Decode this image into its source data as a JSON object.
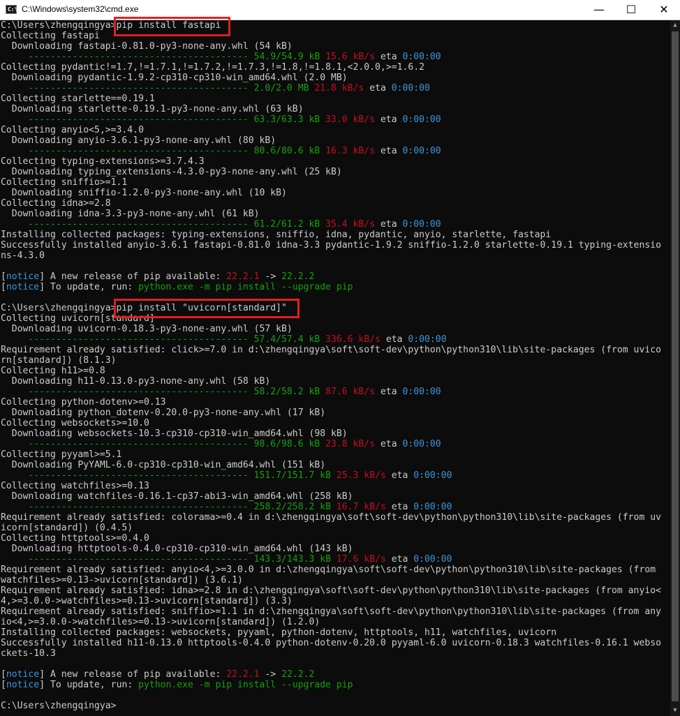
{
  "window": {
    "title": "C:\\Windows\\system32\\cmd.exe",
    "icon": "cmd-icon",
    "minimize_glyph": "—",
    "maximize_glyph": "☐",
    "close_glyph": "✕"
  },
  "colors": {
    "background": "#0c0c0c",
    "text": "#cccccc",
    "green": "#13a10e",
    "red": "#c50f1f",
    "cyan": "#3a96dd",
    "highlight": "#e02020"
  },
  "highlights": [
    {
      "label": "first-command",
      "text": "pip install fastapi"
    },
    {
      "label": "second-command",
      "text": "pip install \"uvicorn[standard]\""
    }
  ],
  "lines": [
    [
      {
        "t": "C:\\Users\\zhengqingya>pip install fastapi"
      }
    ],
    [
      {
        "t": "Collecting fastapi"
      }
    ],
    [
      {
        "t": "  Downloading fastapi-0.81.0-py3-none-any.whl (54 kB)"
      }
    ],
    [
      {
        "t": "     ---------------------------------------- ",
        "c": "g"
      },
      {
        "t": "54.9/54.9 kB",
        "c": "g"
      },
      {
        "t": " "
      },
      {
        "t": "15.6 kB/s",
        "c": "r"
      },
      {
        "t": " eta "
      },
      {
        "t": "0:00:00",
        "c": "c"
      }
    ],
    [
      {
        "t": "Collecting pydantic!=1.7,!=1.7.1,!=1.7.2,!=1.7.3,!=1.8,!=1.8.1,<2.0.0,>=1.6.2"
      }
    ],
    [
      {
        "t": "  Downloading pydantic-1.9.2-cp310-cp310-win_amd64.whl (2.0 MB)"
      }
    ],
    [
      {
        "t": "     ---------------------------------------- ",
        "c": "g"
      },
      {
        "t": "2.0/2.0 MB",
        "c": "g"
      },
      {
        "t": " "
      },
      {
        "t": "21.8 kB/s",
        "c": "r"
      },
      {
        "t": " eta "
      },
      {
        "t": "0:00:00",
        "c": "c"
      }
    ],
    [
      {
        "t": "Collecting starlette==0.19.1"
      }
    ],
    [
      {
        "t": "  Downloading starlette-0.19.1-py3-none-any.whl (63 kB)"
      }
    ],
    [
      {
        "t": "     ---------------------------------------- ",
        "c": "g"
      },
      {
        "t": "63.3/63.3 kB",
        "c": "g"
      },
      {
        "t": " "
      },
      {
        "t": "33.0 kB/s",
        "c": "r"
      },
      {
        "t": " eta "
      },
      {
        "t": "0:00:00",
        "c": "c"
      }
    ],
    [
      {
        "t": "Collecting anyio<5,>=3.4.0"
      }
    ],
    [
      {
        "t": "  Downloading anyio-3.6.1-py3-none-any.whl (80 kB)"
      }
    ],
    [
      {
        "t": "     ---------------------------------------- ",
        "c": "g"
      },
      {
        "t": "80.6/80.6 kB",
        "c": "g"
      },
      {
        "t": " "
      },
      {
        "t": "16.3 kB/s",
        "c": "r"
      },
      {
        "t": " eta "
      },
      {
        "t": "0:00:00",
        "c": "c"
      }
    ],
    [
      {
        "t": "Collecting typing-extensions>=3.7.4.3"
      }
    ],
    [
      {
        "t": "  Downloading typing_extensions-4.3.0-py3-none-any.whl (25 kB)"
      }
    ],
    [
      {
        "t": "Collecting sniffio>=1.1"
      }
    ],
    [
      {
        "t": "  Downloading sniffio-1.2.0-py3-none-any.whl (10 kB)"
      }
    ],
    [
      {
        "t": "Collecting idna>=2.8"
      }
    ],
    [
      {
        "t": "  Downloading idna-3.3-py3-none-any.whl (61 kB)"
      }
    ],
    [
      {
        "t": "     ---------------------------------------- ",
        "c": "g"
      },
      {
        "t": "61.2/61.2 kB",
        "c": "g"
      },
      {
        "t": " "
      },
      {
        "t": "35.4 kB/s",
        "c": "r"
      },
      {
        "t": " eta "
      },
      {
        "t": "0:00:00",
        "c": "c"
      }
    ],
    [
      {
        "t": "Installing collected packages: typing-extensions, sniffio, idna, pydantic, anyio, starlette, fastapi"
      }
    ],
    [
      {
        "t": "Successfully installed anyio-3.6.1 fastapi-0.81.0 idna-3.3 pydantic-1.9.2 sniffio-1.2.0 starlette-0.19.1 typing-extensio"
      }
    ],
    [
      {
        "t": "ns-4.3.0"
      }
    ],
    [
      {
        "t": ""
      }
    ],
    [
      {
        "t": "["
      },
      {
        "t": "notice",
        "c": "c"
      },
      {
        "t": "] A new release of pip available: "
      },
      {
        "t": "22.2.1",
        "c": "r"
      },
      {
        "t": " -> "
      },
      {
        "t": "22.2.2",
        "c": "g"
      }
    ],
    [
      {
        "t": "["
      },
      {
        "t": "notice",
        "c": "c"
      },
      {
        "t": "] To update, run: "
      },
      {
        "t": "python.exe -m pip install --upgrade pip",
        "c": "g"
      }
    ],
    [
      {
        "t": ""
      }
    ],
    [
      {
        "t": "C:\\Users\\zhengqingya>pip install \"uvicorn[standard]\""
      }
    ],
    [
      {
        "t": "Collecting uvicorn[standard]"
      }
    ],
    [
      {
        "t": "  Downloading uvicorn-0.18.3-py3-none-any.whl (57 kB)"
      }
    ],
    [
      {
        "t": "     ---------------------------------------- ",
        "c": "g"
      },
      {
        "t": "57.4/57.4 kB",
        "c": "g"
      },
      {
        "t": " "
      },
      {
        "t": "336.6 kB/s",
        "c": "r"
      },
      {
        "t": " eta "
      },
      {
        "t": "0:00:00",
        "c": "c"
      }
    ],
    [
      {
        "t": "Requirement already satisfied: click>=7.0 in d:\\zhengqingya\\soft\\soft-dev\\python\\python310\\lib\\site-packages (from uvico"
      }
    ],
    [
      {
        "t": "rn[standard]) (8.1.3)"
      }
    ],
    [
      {
        "t": "Collecting h11>=0.8"
      }
    ],
    [
      {
        "t": "  Downloading h11-0.13.0-py3-none-any.whl (58 kB)"
      }
    ],
    [
      {
        "t": "     ---------------------------------------- ",
        "c": "g"
      },
      {
        "t": "58.2/58.2 kB",
        "c": "g"
      },
      {
        "t": " "
      },
      {
        "t": "87.6 kB/s",
        "c": "r"
      },
      {
        "t": " eta "
      },
      {
        "t": "0:00:00",
        "c": "c"
      }
    ],
    [
      {
        "t": "Collecting python-dotenv>=0.13"
      }
    ],
    [
      {
        "t": "  Downloading python_dotenv-0.20.0-py3-none-any.whl (17 kB)"
      }
    ],
    [
      {
        "t": "Collecting websockets>=10.0"
      }
    ],
    [
      {
        "t": "  Downloading websockets-10.3-cp310-cp310-win_amd64.whl (98 kB)"
      }
    ],
    [
      {
        "t": "     ---------------------------------------- ",
        "c": "g"
      },
      {
        "t": "98.6/98.6 kB",
        "c": "g"
      },
      {
        "t": " "
      },
      {
        "t": "23.8 kB/s",
        "c": "r"
      },
      {
        "t": " eta "
      },
      {
        "t": "0:00:00",
        "c": "c"
      }
    ],
    [
      {
        "t": "Collecting pyyaml>=5.1"
      }
    ],
    [
      {
        "t": "  Downloading PyYAML-6.0-cp310-cp310-win_amd64.whl (151 kB)"
      }
    ],
    [
      {
        "t": "     ---------------------------------------- ",
        "c": "g"
      },
      {
        "t": "151.7/151.7 kB",
        "c": "g"
      },
      {
        "t": " "
      },
      {
        "t": "25.3 kB/s",
        "c": "r"
      },
      {
        "t": " eta "
      },
      {
        "t": "0:00:00",
        "c": "c"
      }
    ],
    [
      {
        "t": "Collecting watchfiles>=0.13"
      }
    ],
    [
      {
        "t": "  Downloading watchfiles-0.16.1-cp37-abi3-win_amd64.whl (258 kB)"
      }
    ],
    [
      {
        "t": "     ---------------------------------------- ",
        "c": "g"
      },
      {
        "t": "258.2/258.2 kB",
        "c": "g"
      },
      {
        "t": " "
      },
      {
        "t": "16.7 kB/s",
        "c": "r"
      },
      {
        "t": " eta "
      },
      {
        "t": "0:00:00",
        "c": "c"
      }
    ],
    [
      {
        "t": "Requirement already satisfied: colorama>=0.4 in d:\\zhengqingya\\soft\\soft-dev\\python\\python310\\lib\\site-packages (from uv"
      }
    ],
    [
      {
        "t": "icorn[standard]) (0.4.5)"
      }
    ],
    [
      {
        "t": "Collecting httptools>=0.4.0"
      }
    ],
    [
      {
        "t": "  Downloading httptools-0.4.0-cp310-cp310-win_amd64.whl (143 kB)"
      }
    ],
    [
      {
        "t": "     ---------------------------------------- ",
        "c": "g"
      },
      {
        "t": "143.3/143.3 kB",
        "c": "g"
      },
      {
        "t": " "
      },
      {
        "t": "17.6 kB/s",
        "c": "r"
      },
      {
        "t": " eta "
      },
      {
        "t": "0:00:00",
        "c": "c"
      }
    ],
    [
      {
        "t": "Requirement already satisfied: anyio<4,>=3.0.0 in d:\\zhengqingya\\soft\\soft-dev\\python\\python310\\lib\\site-packages (from"
      }
    ],
    [
      {
        "t": "watchfiles>=0.13->uvicorn[standard]) (3.6.1)"
      }
    ],
    [
      {
        "t": "Requirement already satisfied: idna>=2.8 in d:\\zhengqingya\\soft\\soft-dev\\python\\python310\\lib\\site-packages (from anyio<"
      }
    ],
    [
      {
        "t": "4,>=3.0.0->watchfiles>=0.13->uvicorn[standard]) (3.3)"
      }
    ],
    [
      {
        "t": "Requirement already satisfied: sniffio>=1.1 in d:\\zhengqingya\\soft\\soft-dev\\python\\python310\\lib\\site-packages (from any"
      }
    ],
    [
      {
        "t": "io<4,>=3.0.0->watchfiles>=0.13->uvicorn[standard]) (1.2.0)"
      }
    ],
    [
      {
        "t": "Installing collected packages: websockets, pyyaml, python-dotenv, httptools, h11, watchfiles, uvicorn"
      }
    ],
    [
      {
        "t": "Successfully installed h11-0.13.0 httptools-0.4.0 python-dotenv-0.20.0 pyyaml-6.0 uvicorn-0.18.3 watchfiles-0.16.1 webso"
      }
    ],
    [
      {
        "t": "ckets-10.3"
      }
    ],
    [
      {
        "t": ""
      }
    ],
    [
      {
        "t": "["
      },
      {
        "t": "notice",
        "c": "c"
      },
      {
        "t": "] A new release of pip available: "
      },
      {
        "t": "22.2.1",
        "c": "r"
      },
      {
        "t": " -> "
      },
      {
        "t": "22.2.2",
        "c": "g"
      }
    ],
    [
      {
        "t": "["
      },
      {
        "t": "notice",
        "c": "c"
      },
      {
        "t": "] To update, run: "
      },
      {
        "t": "python.exe -m pip install --upgrade pip",
        "c": "g"
      }
    ],
    [
      {
        "t": ""
      }
    ],
    [
      {
        "t": "C:\\Users\\zhengqingya>"
      }
    ]
  ]
}
